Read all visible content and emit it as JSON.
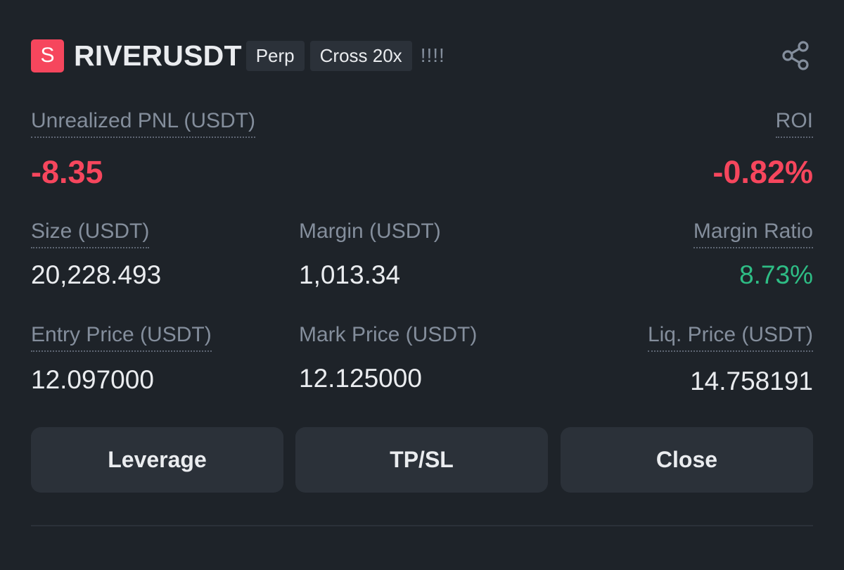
{
  "position": {
    "side_badge": "S",
    "symbol": "RIVERUSDT",
    "type_tag": "Perp",
    "margin_tag": "Cross 20x",
    "risk_indicator": "!!!!",
    "share_icon": "share-icon"
  },
  "pnl": {
    "unrealized_label": "Unrealized PNL (USDT)",
    "unrealized_value": "-8.35",
    "roi_label": "ROI",
    "roi_value": "-0.82%"
  },
  "stats": {
    "size_label": "Size (USDT)",
    "size_value": "20,228.493",
    "margin_label": "Margin (USDT)",
    "margin_value": "1,013.34",
    "margin_ratio_label": "Margin Ratio",
    "margin_ratio_value": "8.73%",
    "entry_label": "Entry Price (USDT)",
    "entry_value": "12.097000",
    "mark_label": "Mark Price (USDT)",
    "mark_value": "12.125000",
    "liq_label": "Liq. Price (USDT)",
    "liq_value": "14.758191"
  },
  "actions": {
    "leverage": "Leverage",
    "tpsl": "TP/SL",
    "close": "Close"
  },
  "colors": {
    "background": "#1e2329",
    "negative": "#f6465d",
    "positive": "#2ebd85",
    "button_bg": "#2b3139"
  }
}
